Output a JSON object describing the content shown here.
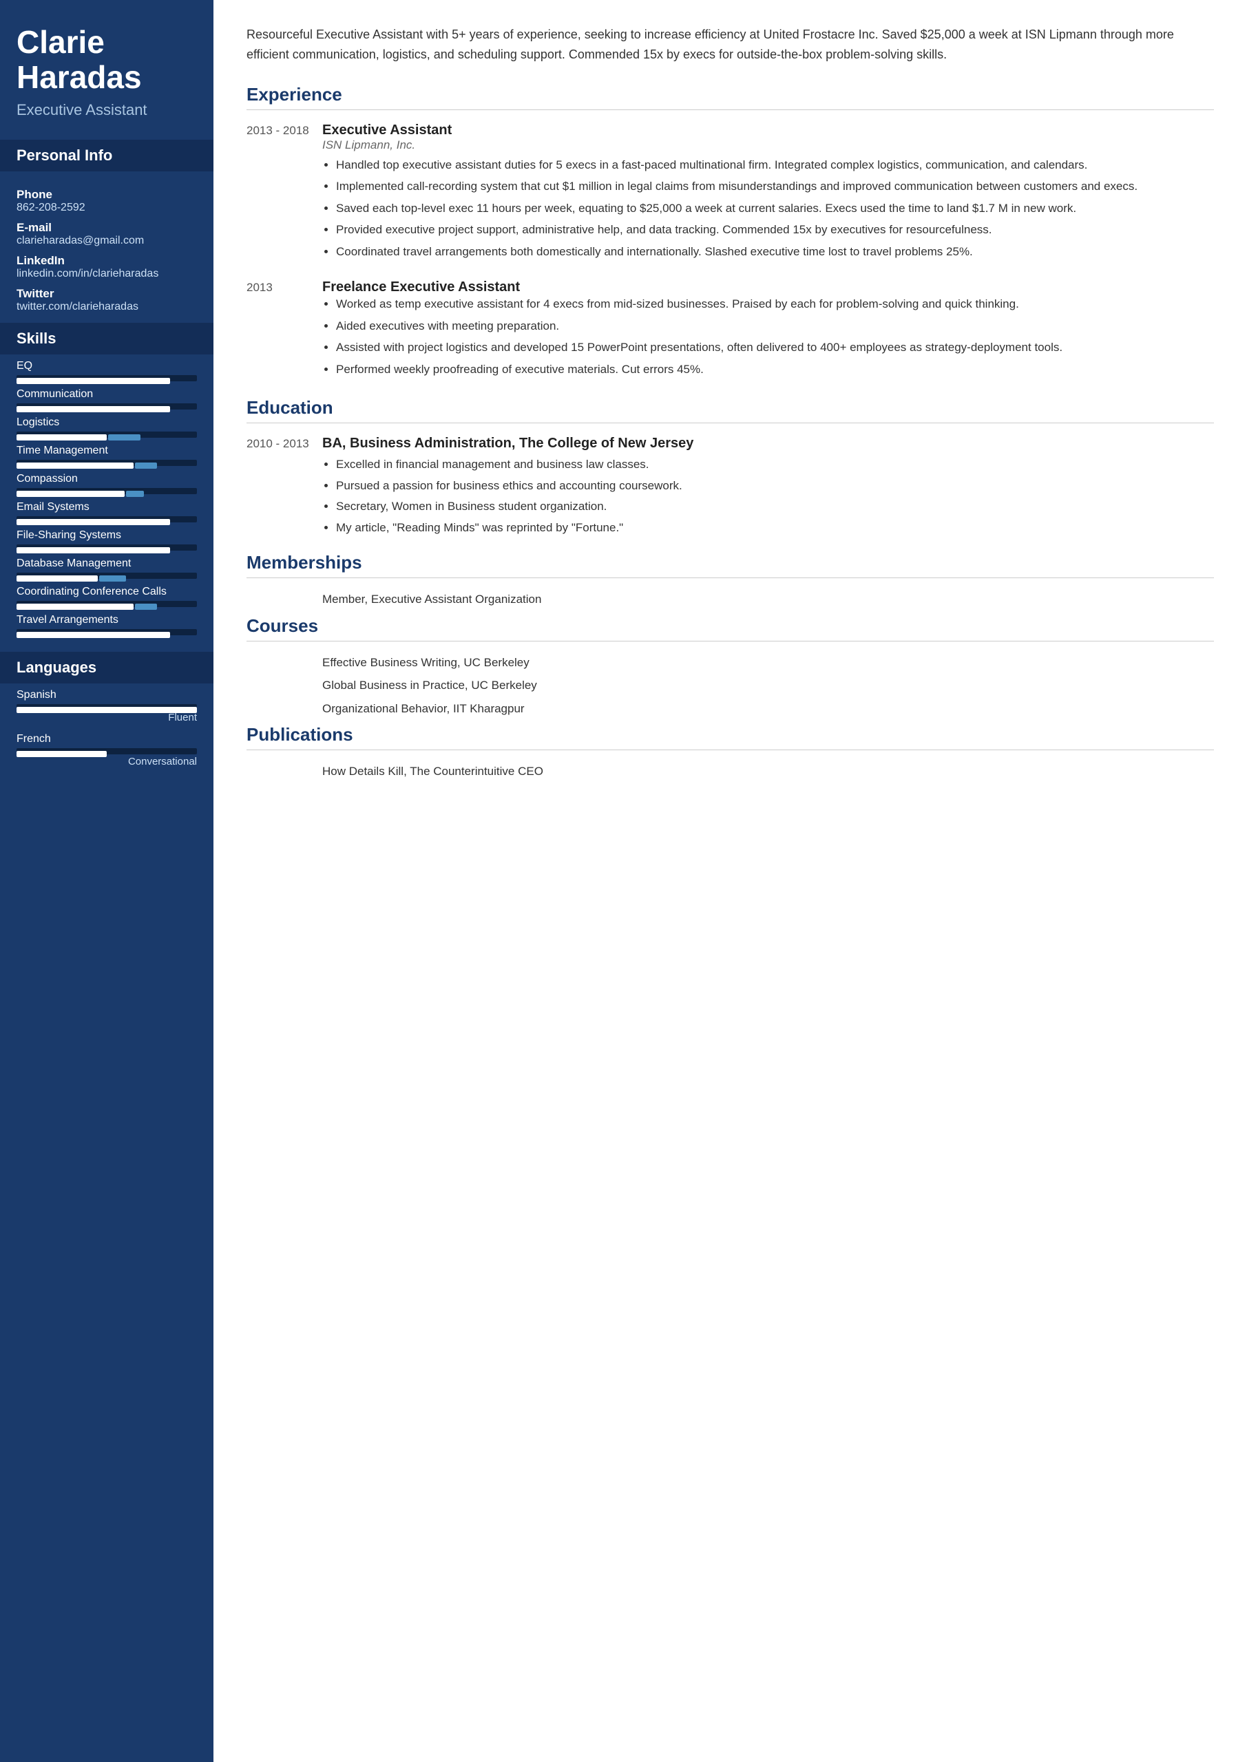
{
  "sidebar": {
    "name_line1": "Clarie",
    "name_line2": "Haradas",
    "title": "Executive Assistant",
    "sections": {
      "personal_info": "Personal Info",
      "skills": "Skills",
      "languages": "Languages"
    },
    "contact": {
      "phone_label": "Phone",
      "phone_value": "862-208-2592",
      "email_label": "E-mail",
      "email_value": "clarieharadas@gmail.com",
      "linkedin_label": "LinkedIn",
      "linkedin_value": "linkedin.com/in/clarieharadas",
      "twitter_label": "Twitter",
      "twitter_value": "twitter.com/clarieharadas"
    },
    "skills": [
      {
        "label": "EQ",
        "fill_pct": 85,
        "accent_pct": 0
      },
      {
        "label": "Communication",
        "fill_pct": 85,
        "accent_pct": 0
      },
      {
        "label": "Logistics",
        "fill_pct": 50,
        "accent_pct": 18
      },
      {
        "label": "Time Management",
        "fill_pct": 65,
        "accent_pct": 12
      },
      {
        "label": "Compassion",
        "fill_pct": 60,
        "accent_pct": 10
      },
      {
        "label": "Email Systems",
        "fill_pct": 85,
        "accent_pct": 0
      },
      {
        "label": "File-Sharing Systems",
        "fill_pct": 85,
        "accent_pct": 0
      },
      {
        "label": "Database Management",
        "fill_pct": 45,
        "accent_pct": 15
      },
      {
        "label": "Coordinating Conference Calls",
        "fill_pct": 65,
        "accent_pct": 12
      },
      {
        "label": "Travel Arrangements",
        "fill_pct": 85,
        "accent_pct": 0
      }
    ],
    "languages": [
      {
        "label": "Spanish",
        "fill_pct": 100,
        "level": "Fluent"
      },
      {
        "label": "French",
        "fill_pct": 50,
        "level": "Conversational"
      }
    ]
  },
  "main": {
    "summary": "Resourceful Executive Assistant with 5+ years of experience, seeking to increase efficiency at United Frostacre Inc. Saved $25,000 a week at ISN Lipmann through more efficient communication, logistics, and scheduling support. Commended 15x by execs for outside-the-box problem-solving skills.",
    "experience_title": "Experience",
    "experience": [
      {
        "dates": "2013 - 2018",
        "title": "Executive Assistant",
        "company": "ISN Lipmann, Inc.",
        "bullets": [
          "Handled top executive assistant duties for 5 execs in a fast-paced multinational firm. Integrated complex logistics, communication, and calendars.",
          "Implemented call-recording system that cut $1 million in legal claims from misunderstandings and improved communication between customers and execs.",
          "Saved each top-level exec 11 hours per week, equating to $25,000 a week at current salaries. Execs used the time to land $1.7 M in new work.",
          "Provided executive project support, administrative help, and data tracking. Commended 15x by executives for resourcefulness.",
          "Coordinated travel arrangements both domestically and internationally. Slashed executive time lost to travel problems 25%."
        ]
      },
      {
        "dates": "2013",
        "title": "Freelance Executive Assistant",
        "company": "",
        "bullets": [
          "Worked as temp executive assistant for 4 execs from mid-sized businesses. Praised by each for problem-solving and quick thinking.",
          "Aided executives with meeting preparation.",
          "Assisted with project logistics and developed 15 PowerPoint presentations, often delivered to 400+ employees as strategy-deployment tools.",
          "Performed weekly proofreading of executive materials. Cut errors 45%."
        ]
      }
    ],
    "education_title": "Education",
    "education": [
      {
        "dates": "2010 - 2013",
        "degree": "BA, Business Administration, The College of New Jersey",
        "bullets": [
          "Excelled in financial management and business law classes.",
          "Pursued a passion for business ethics and accounting coursework.",
          "Secretary, Women in Business student organization.",
          "My article, \"Reading Minds\" was reprinted by \"Fortune.\""
        ]
      }
    ],
    "memberships_title": "Memberships",
    "memberships": [
      "Member, Executive Assistant Organization"
    ],
    "courses_title": "Courses",
    "courses": [
      "Effective Business Writing, UC Berkeley",
      "Global Business in Practice, UC Berkeley",
      "Organizational Behavior, IIT Kharagpur"
    ],
    "publications_title": "Publications",
    "publications": [
      "How Details Kill, The Counterintuitive CEO"
    ]
  }
}
